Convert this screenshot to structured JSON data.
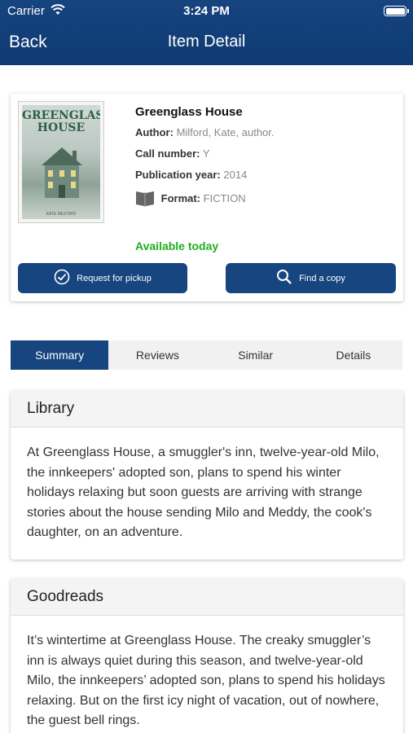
{
  "status": {
    "carrier": "Carrier",
    "time": "3:24 PM"
  },
  "nav": {
    "back_label": "Back",
    "title": "Item Detail"
  },
  "item": {
    "cover": {
      "title_line1": "GREENGLASS",
      "title_line2": "HOUSE",
      "author_small": "KATE MILFORD"
    },
    "title": "Greenglass House",
    "author_label": "Author:",
    "author": "Milford, Kate, author.",
    "call_label": "Call number:",
    "call_number": "Y",
    "year_label": "Publication year:",
    "year": "2014",
    "format_label": "Format:",
    "format": "FICTION",
    "availability": "Available today",
    "availability_color": "#1fae1f",
    "request_label": "Request for pickup",
    "find_label": "Find a copy"
  },
  "tabs": [
    {
      "label": "Summary",
      "active": true
    },
    {
      "label": "Reviews",
      "active": false
    },
    {
      "label": "Similar",
      "active": false
    },
    {
      "label": "Details",
      "active": false
    }
  ],
  "sections": {
    "library": {
      "heading": "Library",
      "text": "At Greenglass House, a smuggler's inn, twelve-year-old Milo, the innkeepers' adopted son, plans to spend his winter holidays relaxing but soon guests are arriving with strange stories about the house sending Milo and Meddy, the cook's daughter, on an adventure."
    },
    "goodreads": {
      "heading": "Goodreads",
      "text": "It’s wintertime at Greenglass House. The creaky smuggler’s inn is always quiet during this season, and twelve-year-old Milo, the innkeepers’ adopted son, plans to spend his holidays relaxing. But on the first icy night of vacation, out of nowhere, the guest bell rings."
    }
  },
  "colors": {
    "brand": "#16457f",
    "accent_green": "#1fae1f"
  },
  "icons": [
    "wifi-icon",
    "battery-icon",
    "book-icon",
    "check-circle-icon",
    "search-icon"
  ]
}
